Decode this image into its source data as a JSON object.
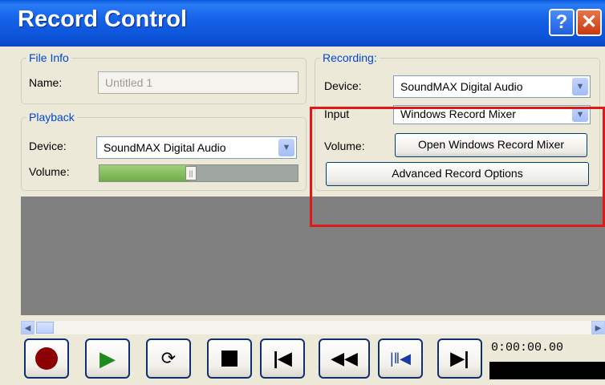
{
  "window": {
    "title": "Record Control",
    "help_glyph": "?",
    "close_glyph": "✕"
  },
  "file_info": {
    "legend": "File Info",
    "name_label": "Name:",
    "name_value": "Untitled 1"
  },
  "playback": {
    "legend": "Playback",
    "device_label": "Device:",
    "device_value": "SoundMAX Digital Audio",
    "volume_label": "Volume:",
    "volume_level_percent": 45
  },
  "recording": {
    "legend": "Recording:",
    "device_label": "Device:",
    "device_value": "SoundMAX Digital Audio",
    "input_label": "Input",
    "input_value": "Windows Record Mixer",
    "volume_label": "Volume:",
    "open_mixer_button": "Open Windows Record Mixer",
    "advanced_button": "Advanced Record Options"
  },
  "transport": {
    "time": "0:00:00.00"
  },
  "colors": {
    "title_bar": "#0a5ae0",
    "accent_text": "#0046d5",
    "highlight": "#e01818",
    "record": "#8b0000",
    "play": "#1d8b1d"
  }
}
